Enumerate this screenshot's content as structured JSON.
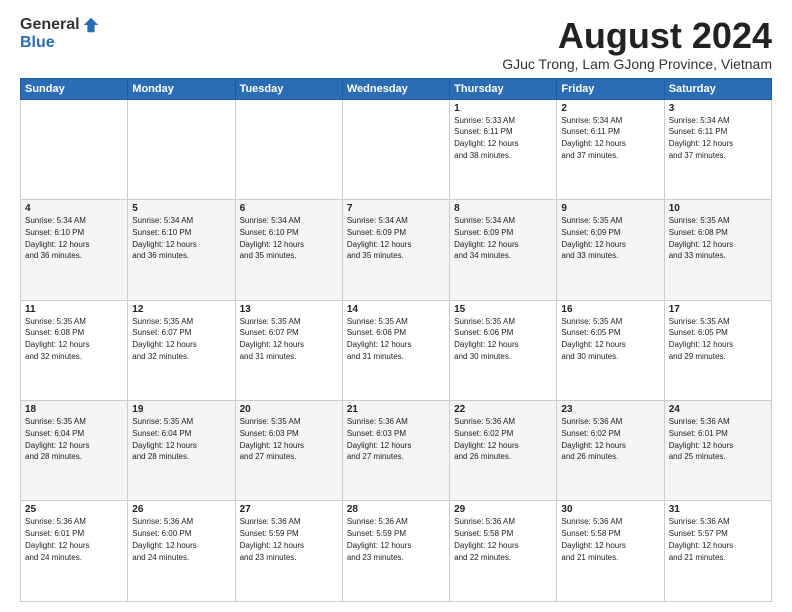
{
  "logo": {
    "general": "General",
    "blue": "Blue"
  },
  "title": "August 2024",
  "location": "GJuc Trong, Lam GJong Province, Vietnam",
  "days_header": [
    "Sunday",
    "Monday",
    "Tuesday",
    "Wednesday",
    "Thursday",
    "Friday",
    "Saturday"
  ],
  "weeks": [
    [
      {
        "day": "",
        "info": ""
      },
      {
        "day": "",
        "info": ""
      },
      {
        "day": "",
        "info": ""
      },
      {
        "day": "",
        "info": ""
      },
      {
        "day": "1",
        "info": "Sunrise: 5:33 AM\nSunset: 6:11 PM\nDaylight: 12 hours\nand 38 minutes."
      },
      {
        "day": "2",
        "info": "Sunrise: 5:34 AM\nSunset: 6:11 PM\nDaylight: 12 hours\nand 37 minutes."
      },
      {
        "day": "3",
        "info": "Sunrise: 5:34 AM\nSunset: 6:11 PM\nDaylight: 12 hours\nand 37 minutes."
      }
    ],
    [
      {
        "day": "4",
        "info": "Sunrise: 5:34 AM\nSunset: 6:10 PM\nDaylight: 12 hours\nand 36 minutes."
      },
      {
        "day": "5",
        "info": "Sunrise: 5:34 AM\nSunset: 6:10 PM\nDaylight: 12 hours\nand 36 minutes."
      },
      {
        "day": "6",
        "info": "Sunrise: 5:34 AM\nSunset: 6:10 PM\nDaylight: 12 hours\nand 35 minutes."
      },
      {
        "day": "7",
        "info": "Sunrise: 5:34 AM\nSunset: 6:09 PM\nDaylight: 12 hours\nand 35 minutes."
      },
      {
        "day": "8",
        "info": "Sunrise: 5:34 AM\nSunset: 6:09 PM\nDaylight: 12 hours\nand 34 minutes."
      },
      {
        "day": "9",
        "info": "Sunrise: 5:35 AM\nSunset: 6:09 PM\nDaylight: 12 hours\nand 33 minutes."
      },
      {
        "day": "10",
        "info": "Sunrise: 5:35 AM\nSunset: 6:08 PM\nDaylight: 12 hours\nand 33 minutes."
      }
    ],
    [
      {
        "day": "11",
        "info": "Sunrise: 5:35 AM\nSunset: 6:08 PM\nDaylight: 12 hours\nand 32 minutes."
      },
      {
        "day": "12",
        "info": "Sunrise: 5:35 AM\nSunset: 6:07 PM\nDaylight: 12 hours\nand 32 minutes."
      },
      {
        "day": "13",
        "info": "Sunrise: 5:35 AM\nSunset: 6:07 PM\nDaylight: 12 hours\nand 31 minutes."
      },
      {
        "day": "14",
        "info": "Sunrise: 5:35 AM\nSunset: 6:06 PM\nDaylight: 12 hours\nand 31 minutes."
      },
      {
        "day": "15",
        "info": "Sunrise: 5:35 AM\nSunset: 6:06 PM\nDaylight: 12 hours\nand 30 minutes."
      },
      {
        "day": "16",
        "info": "Sunrise: 5:35 AM\nSunset: 6:05 PM\nDaylight: 12 hours\nand 30 minutes."
      },
      {
        "day": "17",
        "info": "Sunrise: 5:35 AM\nSunset: 6:05 PM\nDaylight: 12 hours\nand 29 minutes."
      }
    ],
    [
      {
        "day": "18",
        "info": "Sunrise: 5:35 AM\nSunset: 6:04 PM\nDaylight: 12 hours\nand 28 minutes."
      },
      {
        "day": "19",
        "info": "Sunrise: 5:35 AM\nSunset: 6:04 PM\nDaylight: 12 hours\nand 28 minutes."
      },
      {
        "day": "20",
        "info": "Sunrise: 5:35 AM\nSunset: 6:03 PM\nDaylight: 12 hours\nand 27 minutes."
      },
      {
        "day": "21",
        "info": "Sunrise: 5:36 AM\nSunset: 6:03 PM\nDaylight: 12 hours\nand 27 minutes."
      },
      {
        "day": "22",
        "info": "Sunrise: 5:36 AM\nSunset: 6:02 PM\nDaylight: 12 hours\nand 26 minutes."
      },
      {
        "day": "23",
        "info": "Sunrise: 5:36 AM\nSunset: 6:02 PM\nDaylight: 12 hours\nand 26 minutes."
      },
      {
        "day": "24",
        "info": "Sunrise: 5:36 AM\nSunset: 6:01 PM\nDaylight: 12 hours\nand 25 minutes."
      }
    ],
    [
      {
        "day": "25",
        "info": "Sunrise: 5:36 AM\nSunset: 6:01 PM\nDaylight: 12 hours\nand 24 minutes."
      },
      {
        "day": "26",
        "info": "Sunrise: 5:36 AM\nSunset: 6:00 PM\nDaylight: 12 hours\nand 24 minutes."
      },
      {
        "day": "27",
        "info": "Sunrise: 5:36 AM\nSunset: 5:59 PM\nDaylight: 12 hours\nand 23 minutes."
      },
      {
        "day": "28",
        "info": "Sunrise: 5:36 AM\nSunset: 5:59 PM\nDaylight: 12 hours\nand 23 minutes."
      },
      {
        "day": "29",
        "info": "Sunrise: 5:36 AM\nSunset: 5:58 PM\nDaylight: 12 hours\nand 22 minutes."
      },
      {
        "day": "30",
        "info": "Sunrise: 5:36 AM\nSunset: 5:58 PM\nDaylight: 12 hours\nand 21 minutes."
      },
      {
        "day": "31",
        "info": "Sunrise: 5:36 AM\nSunset: 5:57 PM\nDaylight: 12 hours\nand 21 minutes."
      }
    ]
  ]
}
